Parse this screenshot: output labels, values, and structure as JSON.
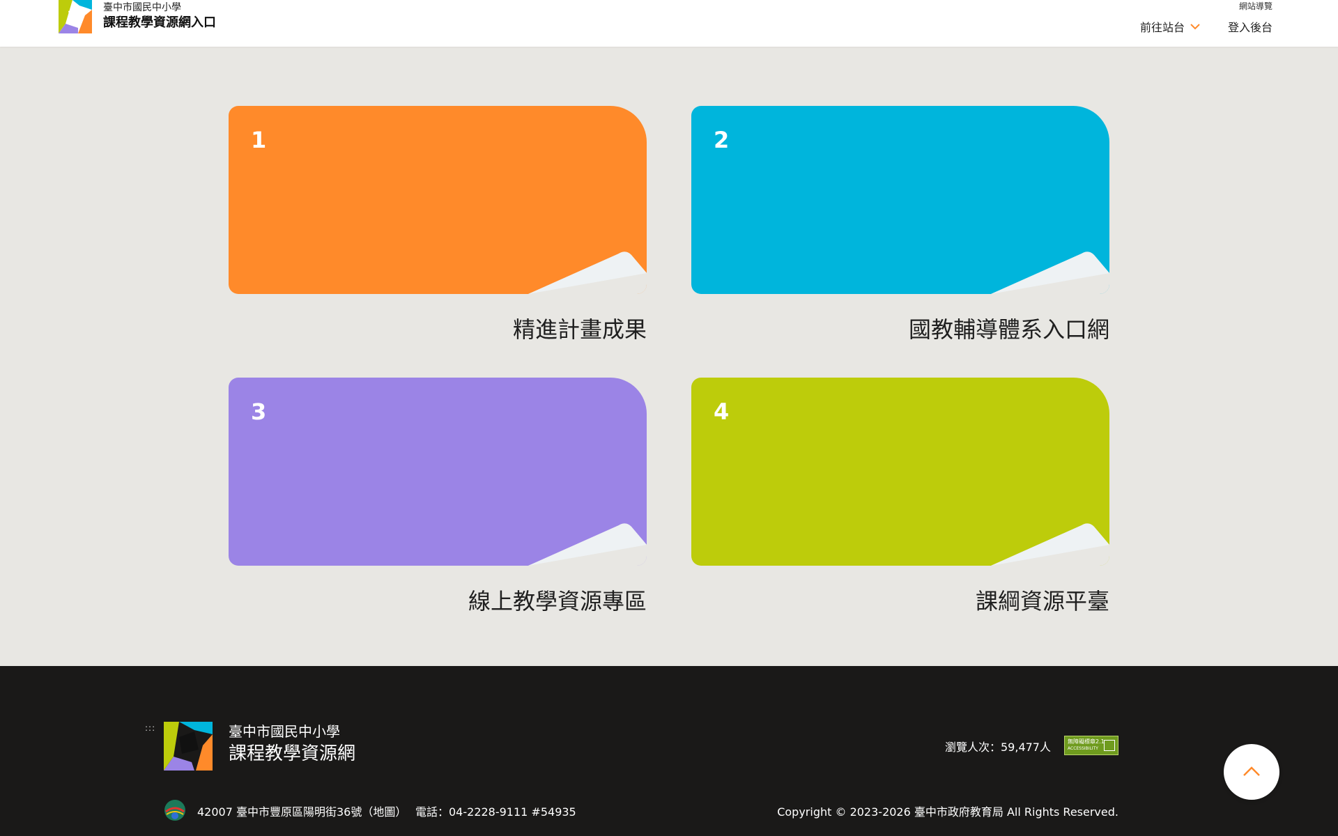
{
  "header": {
    "brand_sub": "臺中市國民中小學",
    "brand_main": "課程教學資源網入口",
    "sitemap": "網站導覽",
    "nav": [
      {
        "label": "前往站台",
        "icon": "chevron-down-icon"
      },
      {
        "label": "登入後台"
      }
    ]
  },
  "cards": [
    {
      "num": "1",
      "title": "精進計畫成果",
      "color": "#ff8a2a"
    },
    {
      "num": "2",
      "title": "國教輔導體系入口網",
      "color": "#00b5dc"
    },
    {
      "num": "3",
      "title": "線上教學資源專區",
      "color": "#9b84e6"
    },
    {
      "num": "4",
      "title": "課綱資源平臺",
      "color": "#bdcc0b"
    }
  ],
  "footer": {
    "access_key": ":::",
    "brand_sub": "臺中市國民中小學",
    "brand_main": "課程教學資源網",
    "visitors": "瀏覽人次：59,477人",
    "badge_line1": "無障礙標章2.1",
    "badge_line2": "ACCESSIBILITY",
    "address": "42007 臺中市豐原區陽明街36號（地圖）",
    "phone": "電話：04-2228-9111 #54935",
    "copyright": "Copyright © 2023-2026 臺中市政府教育局 All Rights Reserved."
  },
  "colors": {
    "accent_orange": "#ff8a2a",
    "footer_bg": "#1a1918",
    "page_bg": "#e8e7e3"
  }
}
